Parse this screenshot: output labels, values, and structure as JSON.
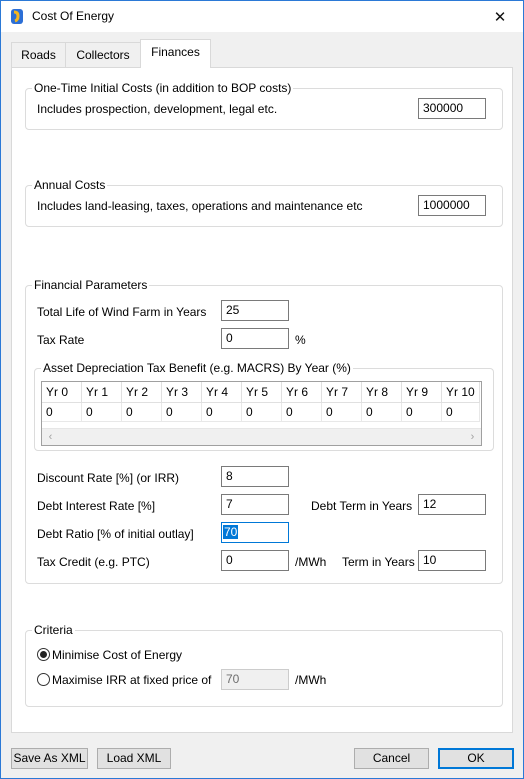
{
  "window": {
    "title": "Cost Of Energy",
    "close_glyph": "✕"
  },
  "tabs": [
    {
      "label": "Roads"
    },
    {
      "label": "Collectors"
    },
    {
      "label": "Finances"
    }
  ],
  "one_time": {
    "title": "One-Time Initial Costs (in addition to BOP costs)",
    "label": "Includes prospection, development, legal etc.",
    "value": "300000"
  },
  "annual": {
    "title": "Annual Costs",
    "label": "Includes land-leasing, taxes, operations and maintenance etc",
    "value": "1000000"
  },
  "financial": {
    "title": "Financial Parameters",
    "life_label": "Total Life of Wind Farm in Years",
    "life_value": "25",
    "tax_label": "Tax Rate",
    "tax_value": "0",
    "tax_unit": "%",
    "depreciation": {
      "title": "Asset Depreciation Tax Benefit (e.g. MACRS) By Year (%)",
      "headers": [
        "Yr 0",
        "Yr 1",
        "Yr 2",
        "Yr 3",
        "Yr 4",
        "Yr 5",
        "Yr 6",
        "Yr 7",
        "Yr 8",
        "Yr 9",
        "Yr 10"
      ],
      "values": [
        "0",
        "0",
        "0",
        "0",
        "0",
        "0",
        "0",
        "0",
        "0",
        "0",
        "0"
      ],
      "scroll_left": "‹",
      "scroll_right": "›"
    },
    "discount_label": "Discount Rate [%] (or IRR)",
    "discount_value": "8",
    "debt_interest_label": "Debt Interest Rate [%]",
    "debt_interest_value": "7",
    "debt_term_label": "Debt Term in Years",
    "debt_term_value": "12",
    "debt_ratio_label": "Debt Ratio [% of initial outlay]",
    "debt_ratio_value": "70",
    "tax_credit_label": "Tax Credit (e.g. PTC)",
    "tax_credit_value": "0",
    "tax_credit_unit": "/MWh",
    "credit_term_label": "Term in Years",
    "credit_term_value": "10"
  },
  "criteria": {
    "title": "Criteria",
    "option1": "Minimise Cost of Energy",
    "option2": "Maximise IRR at fixed price of",
    "price_value": "70",
    "price_unit": "/MWh",
    "selected": "option1"
  },
  "buttons": {
    "save_xml": "Save As XML",
    "load_xml": "Load XML",
    "cancel": "Cancel",
    "ok": "OK"
  }
}
